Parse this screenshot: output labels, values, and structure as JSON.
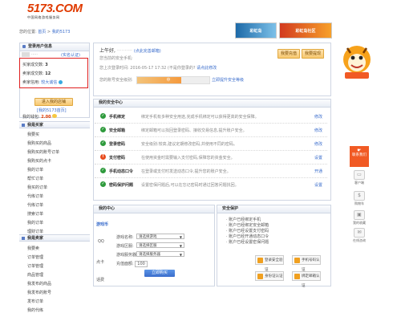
{
  "brand": {
    "logo_text": "5173.COM",
    "tagline": "中国网络游戏服务网"
  },
  "banners": {
    "left": "彩虹岛",
    "right": "彩虹岛社区"
  },
  "breadcrumb": {
    "prefix": "您的位置:",
    "home": "首页",
    "sep": ">",
    "current": "我的5173"
  },
  "account_panel": {
    "title": "登录用户信息",
    "username_masked": "·····",
    "verified_tag": "(实名认证)",
    "buy_count_label": "买家成交数:",
    "buy_count": "3",
    "sell_count_label": "卖家成交数:",
    "sell_count": "12",
    "credit_label": "卖家信用:",
    "credit_value": "较大诚信",
    "enter_shop": "进入我的店铺",
    "shop_link": "[我的5173首页]",
    "balance_label": "我的钱包:",
    "balance": "2.00"
  },
  "buyer_menu": {
    "title": "我是买家",
    "items": [
      "我要买",
      "我购买的商品",
      "我购买的账号订单",
      "我购买的点卡",
      "我的订单",
      "帮忙订单",
      "我买的订单",
      "代练订单",
      "代练订单",
      "搜索订单",
      "我的订单",
      "理财订单",
      "发布订单"
    ]
  },
  "seller_menu": {
    "title": "我是卖家",
    "items": [
      "我要卖",
      "订单管理",
      "订单管理",
      "商品管理",
      "我发布的商品",
      "我发布的账号",
      "发布订单",
      "我的代练",
      "我的订单",
      "我的上架"
    ]
  },
  "welcome": {
    "greeting": "上午好,",
    "name_masked": "··········",
    "mail_link": "(点此完善邮箱)",
    "phone_note": "您当前的安全手机:",
    "last_login": "您上次登录时间: 2016-05-17 17:32 (不是你登录的?",
    "change_pwd": "请点此修改",
    "rank_label": "您的账号安全级别:",
    "rank_state": "中",
    "upgrade_link": "立即提升安全等级",
    "btn_recharge": "我要充值",
    "btn_withdraw": "我要提现"
  },
  "security": {
    "title": "我的安全中心",
    "rows": [
      {
        "title": "手机绑定",
        "desc": "绑定手机有多种安全用途,完成手机绑定可以获得更高的安全保障。",
        "action": "修改",
        "ok": true
      },
      {
        "title": "安全邮箱",
        "desc": "绑定邮箱可以找回登录密码、接收交易信息,提升账户安全。",
        "action": "修改",
        "ok": true
      },
      {
        "title": "登录密码",
        "desc": "安全级别:较高,建议定期修改密码,并使用不同的密码。",
        "action": "修改",
        "ok": true
      },
      {
        "title": "支付密码",
        "desc": "在使用资金时需要输入支付密码,保障您的资金安全。",
        "action": "设置",
        "ok": false
      },
      {
        "title": "手机动态口令",
        "desc": "在登录或支付时发送动态口令,提升您的账户安全。",
        "action": "开通",
        "ok": true
      },
      {
        "title": "密码保护问题",
        "desc": "设置密保问题后,可以在忘记密码时通过回答问题找回。",
        "action": "设置",
        "ok": true
      }
    ]
  },
  "recharge": {
    "title": "我的中心",
    "tabs": [
      "游戏币",
      "点卡"
    ],
    "qq_label": "QQ",
    "card_label": "点卡",
    "other_label": "话费",
    "game_label": "游戏名称:",
    "game_placeholder": "请选择游戏",
    "area_label": "游戏区服:",
    "area_placeholder": "请选择区服",
    "server_label": "游戏服务器:",
    "server_placeholder": "请选择服务器",
    "amount_label": "充值面额:",
    "amount_value": "100",
    "submit": "立即购买"
  },
  "security_center": {
    "title": "安全保护",
    "checks": [
      "· 账户已经绑定手机",
      "· 账户已经绑定安全邮箱",
      "· 账户已经设置支付密码",
      "· 账户已经开通动态口令",
      "· 账户已经设置密保问题"
    ],
    "buttons": [
      "登录安全验证",
      "手机号码认证",
      "身份证认证",
      "绑定邮箱认证"
    ]
  },
  "side_rail": {
    "badge_label": "联系我们",
    "items": [
      "客户端",
      "购物车",
      "我的收藏",
      "在线咨询"
    ]
  },
  "colors": {
    "accent": "#e03a00",
    "link": "#3a6dcc",
    "ok": "#2e9a3c",
    "warn": "#e84c1e",
    "highlight_box": "#e02020"
  }
}
